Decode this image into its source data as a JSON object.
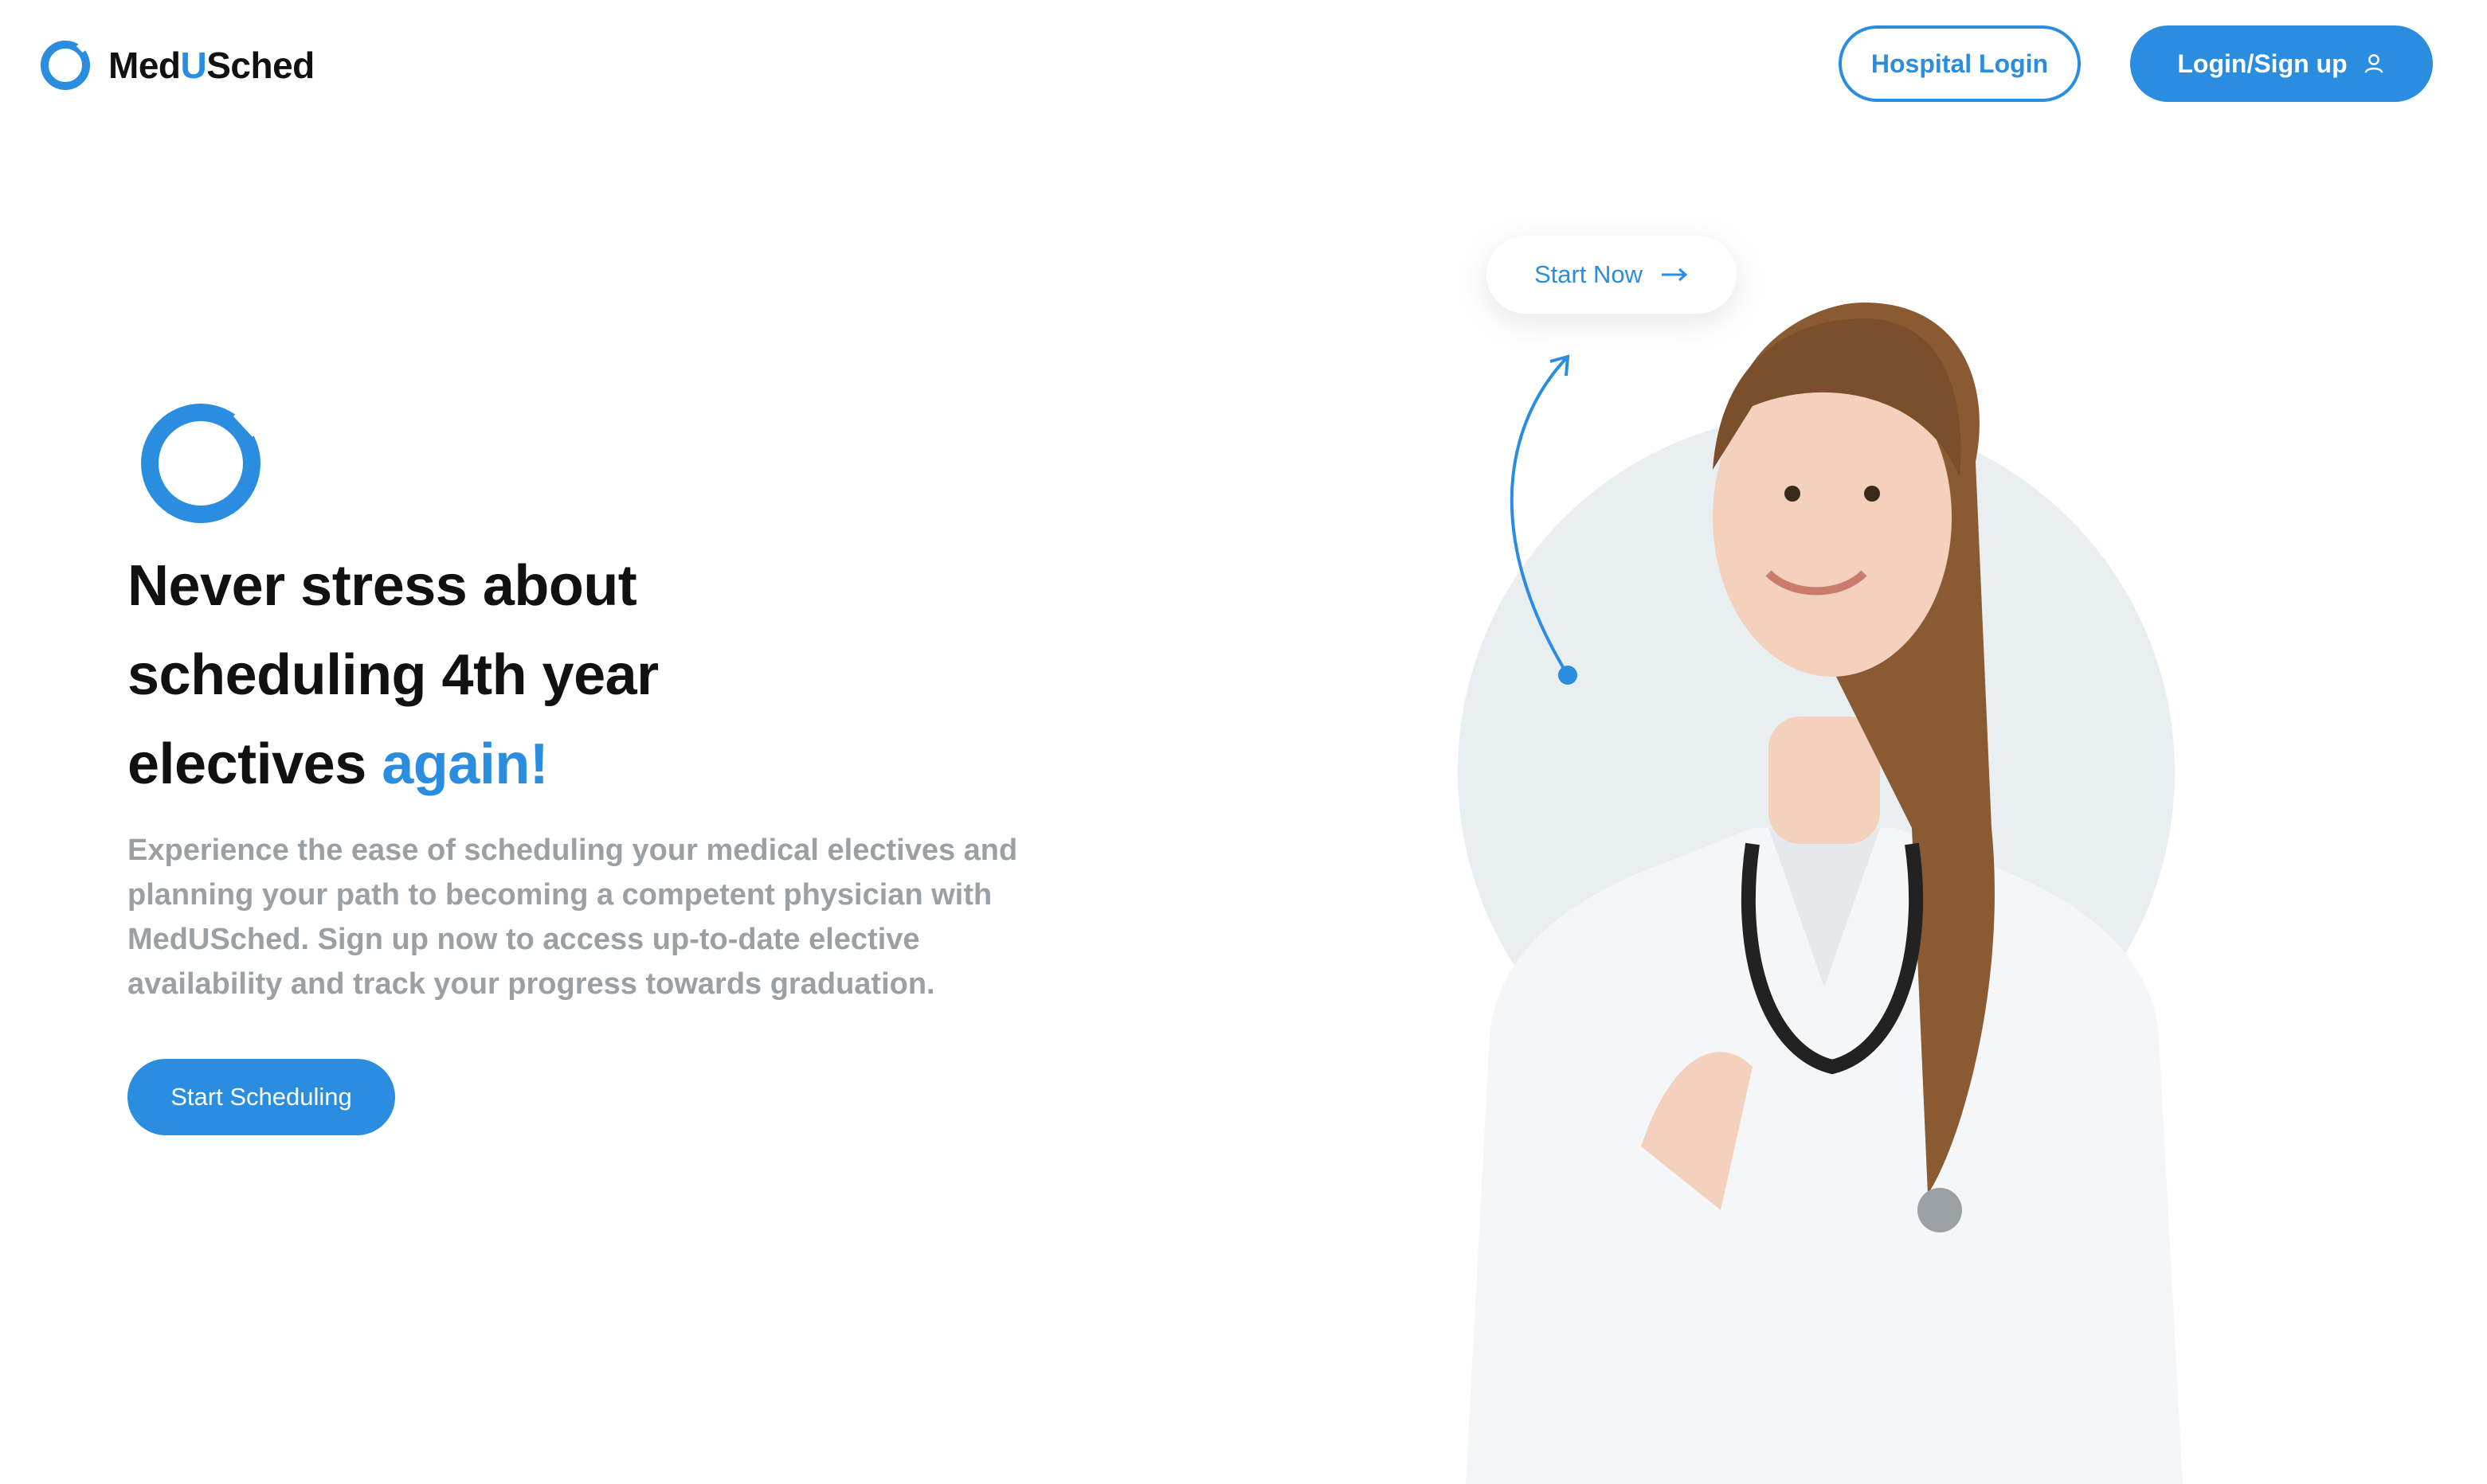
{
  "header": {
    "brand": {
      "part1": "Med",
      "part2": "U",
      "part3": "Sched"
    },
    "hospital_login_label": "Hospital Login",
    "login_signup_label": "Login/Sign up"
  },
  "hero": {
    "headline": {
      "line1": "Never stress about",
      "line2": "scheduling 4th year",
      "line3_prefix": "electives ",
      "line3_accent": "again!"
    },
    "description": "Experience the ease of scheduling your medical electives and planning your path to becoming a competent physician with MedUSched. Sign up now to access up-to-date elective availability and track your progress towards graduation.",
    "cta_label": "Start Scheduling"
  },
  "visual": {
    "start_now_label": "Start Now",
    "icons": [
      "ring-logo-icon",
      "user-icon",
      "arrow-right-icon",
      "curved-arrow-icon"
    ]
  },
  "colors": {
    "accent": "#2b8de0",
    "text_dark": "#111111",
    "text_muted": "#9aa0a4",
    "blob": "#e9eff1"
  }
}
